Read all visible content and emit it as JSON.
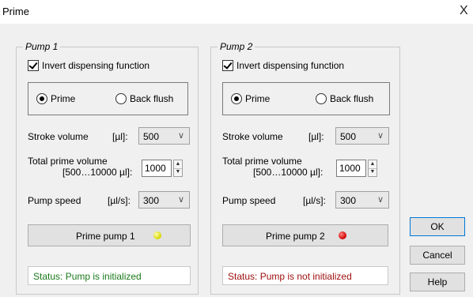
{
  "window": {
    "title": "Prime",
    "close_symbol": "X"
  },
  "pump1": {
    "group_label": "Pump 1",
    "invert_label": "Invert dispensing function",
    "invert_checked": true,
    "mode_prime_label": "Prime",
    "mode_backflush_label": "Back flush",
    "selected_mode": "Prime",
    "stroke_label": "Stroke volume",
    "stroke_unit": "[µl]:",
    "stroke_value": "500",
    "total_label_line1": "Total prime volume",
    "total_label_line2": "[500…10000 µl]:",
    "total_value": "1000",
    "speed_label": "Pump speed",
    "speed_unit": "[µl/s]:",
    "speed_value": "300",
    "prime_button_label": "Prime pump 1",
    "led_color": "yellow",
    "status_text": "Status: Pump is initialized",
    "status_color": "#1a7a1a"
  },
  "pump2": {
    "group_label": "Pump 2",
    "invert_label": "Invert dispensing function",
    "invert_checked": true,
    "mode_prime_label": "Prime",
    "mode_backflush_label": "Back flush",
    "selected_mode": "Prime",
    "stroke_label": "Stroke volume",
    "stroke_unit": "[µl]:",
    "stroke_value": "500",
    "total_label_line1": "Total prime volume",
    "total_label_line2": "[500…10000 µl]:",
    "total_value": "1000",
    "speed_label": "Pump speed",
    "speed_unit": "[µl/s]:",
    "speed_value": "300",
    "prime_button_label": "Prime pump 2",
    "led_color": "red",
    "status_text": "Status: Pump is not initialized",
    "status_color": "#a01010"
  },
  "buttons": {
    "ok": "OK",
    "cancel": "Cancel",
    "help": "Help"
  },
  "icons": {
    "chevron": "chevron-down-icon",
    "spin_up": "arrow-up-icon",
    "spin_down": "arrow-down-icon"
  }
}
